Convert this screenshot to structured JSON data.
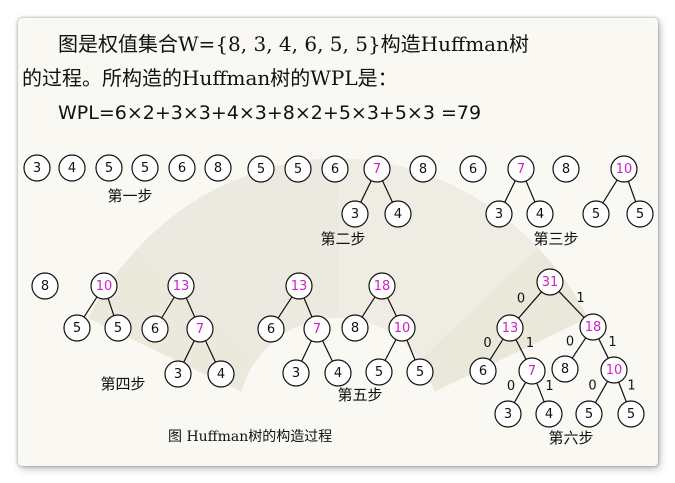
{
  "intro": {
    "line1": "图是权值集合W={8, 3, 4, 6, 5, 5}构造Huffman树",
    "line2": "的过程。所构造的Huffman树的WPL是："
  },
  "formula": "WPL=6×2+3×3+4×3+8×2+5×3+5×3 =79",
  "caption": "图 Huffman树的构造过程",
  "colors": {
    "normal_weight": "#111111",
    "merged_weight": "#d020c8",
    "node_fill": "#ffffff"
  },
  "steps": [
    {
      "label": "第一步",
      "nodes": [
        {
          "id": "a",
          "w": "3"
        },
        {
          "id": "b",
          "w": "4"
        },
        {
          "id": "c",
          "w": "5"
        },
        {
          "id": "d",
          "w": "5"
        },
        {
          "id": "e",
          "w": "6"
        },
        {
          "id": "f",
          "w": "8"
        }
      ],
      "edges": []
    },
    {
      "label": "第二步",
      "nodes": [
        {
          "id": "a",
          "w": "5"
        },
        {
          "id": "b",
          "w": "5"
        },
        {
          "id": "c",
          "w": "6"
        },
        {
          "id": "d",
          "w": "7",
          "merged": true
        },
        {
          "id": "e",
          "w": "8"
        },
        {
          "id": "f",
          "w": "3"
        },
        {
          "id": "g",
          "w": "4"
        }
      ],
      "edges": [
        [
          "d",
          "f"
        ],
        [
          "d",
          "g"
        ]
      ]
    },
    {
      "label": "第三步",
      "nodes": [
        {
          "id": "a",
          "w": "6"
        },
        {
          "id": "b",
          "w": "7",
          "merged": true
        },
        {
          "id": "c",
          "w": "8"
        },
        {
          "id": "d",
          "w": "10",
          "merged": true
        },
        {
          "id": "e",
          "w": "3"
        },
        {
          "id": "f",
          "w": "4"
        },
        {
          "id": "g",
          "w": "5"
        },
        {
          "id": "h",
          "w": "5"
        }
      ],
      "edges": [
        [
          "b",
          "e"
        ],
        [
          "b",
          "f"
        ],
        [
          "d",
          "g"
        ],
        [
          "d",
          "h"
        ]
      ]
    },
    {
      "label": "第四步",
      "nodes": [
        {
          "id": "a",
          "w": "8"
        },
        {
          "id": "b",
          "w": "10",
          "merged": true
        },
        {
          "id": "c",
          "w": "5"
        },
        {
          "id": "d",
          "w": "5"
        },
        {
          "id": "e",
          "w": "13",
          "merged": true
        },
        {
          "id": "f",
          "w": "6"
        },
        {
          "id": "g",
          "w": "7",
          "merged": true
        },
        {
          "id": "h",
          "w": "3"
        },
        {
          "id": "i",
          "w": "4"
        }
      ],
      "edges": [
        [
          "b",
          "c"
        ],
        [
          "b",
          "d"
        ],
        [
          "e",
          "f"
        ],
        [
          "e",
          "g"
        ],
        [
          "g",
          "h"
        ],
        [
          "g",
          "i"
        ]
      ]
    },
    {
      "label": "第五步",
      "nodes": [
        {
          "id": "a",
          "w": "13",
          "merged": true
        },
        {
          "id": "b",
          "w": "6"
        },
        {
          "id": "c",
          "w": "7",
          "merged": true
        },
        {
          "id": "d",
          "w": "3"
        },
        {
          "id": "e",
          "w": "4"
        },
        {
          "id": "f",
          "w": "18",
          "merged": true
        },
        {
          "id": "g",
          "w": "8"
        },
        {
          "id": "h",
          "w": "10",
          "merged": true
        },
        {
          "id": "i",
          "w": "5"
        },
        {
          "id": "j",
          "w": "5"
        }
      ],
      "edges": [
        [
          "a",
          "b"
        ],
        [
          "a",
          "c"
        ],
        [
          "c",
          "d"
        ],
        [
          "c",
          "e"
        ],
        [
          "f",
          "g"
        ],
        [
          "f",
          "h"
        ],
        [
          "h",
          "i"
        ],
        [
          "h",
          "j"
        ]
      ]
    },
    {
      "label": "第六步",
      "nodes": [
        {
          "id": "r",
          "w": "31",
          "merged": true
        },
        {
          "id": "a",
          "w": "13",
          "merged": true
        },
        {
          "id": "b",
          "w": "18",
          "merged": true
        },
        {
          "id": "c",
          "w": "6"
        },
        {
          "id": "d",
          "w": "7",
          "merged": true
        },
        {
          "id": "e",
          "w": "8"
        },
        {
          "id": "f",
          "w": "10",
          "merged": true
        },
        {
          "id": "g",
          "w": "3"
        },
        {
          "id": "h",
          "w": "4"
        },
        {
          "id": "i",
          "w": "5"
        },
        {
          "id": "j",
          "w": "5"
        }
      ],
      "edges": [
        [
          "r",
          "a",
          "0"
        ],
        [
          "r",
          "b",
          "1"
        ],
        [
          "a",
          "c",
          "0"
        ],
        [
          "a",
          "d",
          "1"
        ],
        [
          "b",
          "e",
          "0"
        ],
        [
          "b",
          "f",
          "1"
        ],
        [
          "d",
          "g",
          "0"
        ],
        [
          "d",
          "h",
          "1"
        ],
        [
          "f",
          "i",
          "0"
        ],
        [
          "f",
          "j",
          "1"
        ]
      ]
    }
  ]
}
